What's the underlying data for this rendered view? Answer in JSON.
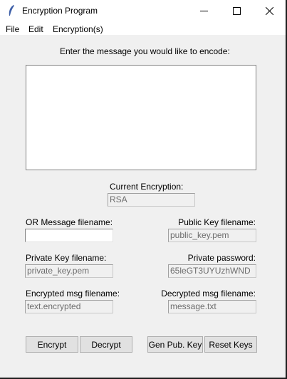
{
  "window": {
    "title": "Encryption Program"
  },
  "menu": [
    "File",
    "Edit",
    "Encryption(s)"
  ],
  "prompt": "Enter the message you would like to encode:",
  "message": "",
  "current_encryption": {
    "label": "Current Encryption:",
    "value": "RSA"
  },
  "fields": {
    "message_filename": {
      "label": "OR Message filename:",
      "value": ""
    },
    "public_key": {
      "label": "Public Key filename:",
      "value": "public_key.pem"
    },
    "private_key": {
      "label": "Private Key filename:",
      "value": "private_key.pem"
    },
    "private_password": {
      "label": "Private password:",
      "value": "65leGT3UYUzhWND"
    },
    "encrypted_filename": {
      "label": "Encrypted msg filename:",
      "value": "text.encrypted"
    },
    "decrypted_filename": {
      "label": "Decrypted msg filename:",
      "value": "message.txt"
    }
  },
  "buttons": {
    "encrypt": "Encrypt",
    "decrypt": "Decrypt",
    "gen_pub_key": "Gen Pub. Key",
    "reset_keys": "Reset Keys"
  }
}
